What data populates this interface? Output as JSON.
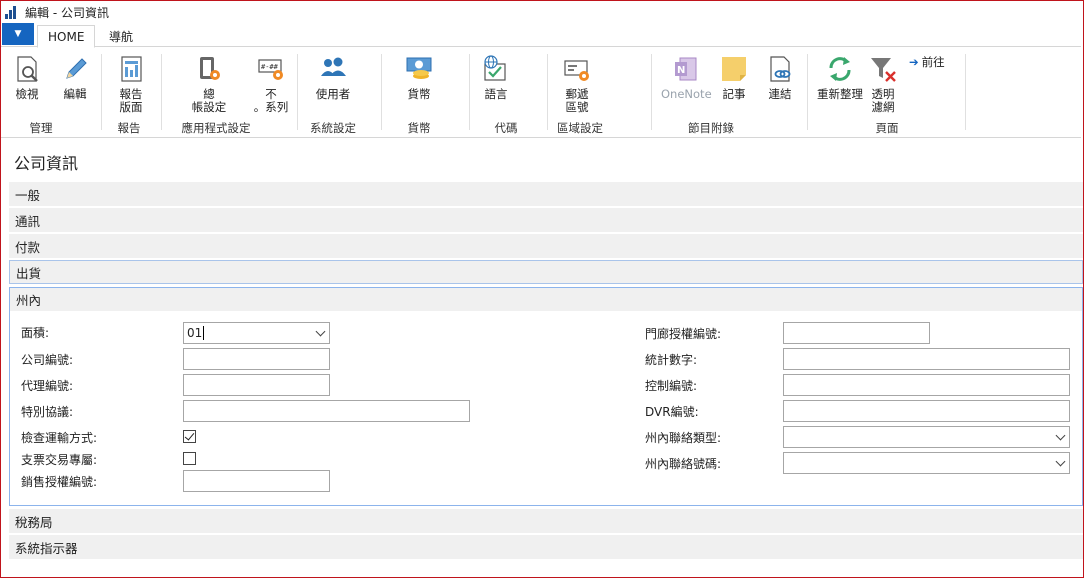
{
  "window": {
    "title": "編輯 - 公司資訊"
  },
  "tabs": [
    {
      "label": "HOME"
    },
    {
      "label": "導航"
    }
  ],
  "ribbon": {
    "buttons": {
      "view": "檢視",
      "edit": "編輯",
      "report_layout_1": "報告",
      "report_layout_2": "版面",
      "gl_setup_1": "總",
      "gl_setup_2": "帳設定",
      "no_series_1": "不",
      "no_series_2": "。系列",
      "users": "使用者",
      "currency": "貨幣",
      "language": "語言",
      "postcode_1": "郵遞",
      "postcode_2": "區號",
      "onenote": "OneNote",
      "notes": "記事",
      "links": "連結",
      "refresh": "重新整理",
      "clear_filter_1": "透明",
      "clear_filter_2": "濾網",
      "goto": "前往"
    },
    "groups": {
      "manage": "管理",
      "report": "報告",
      "app_setup": "應用程式設定",
      "system_setup": "系統設定",
      "currency": "貨幣",
      "codes": "代碼",
      "regional": "區域設定",
      "show_attached": "節目附錄",
      "page": "頁面"
    }
  },
  "page": {
    "title": "公司資訊"
  },
  "sections": {
    "general": "一般",
    "communication": "通訊",
    "payments": "付款",
    "shipping": "出貨",
    "intrastat": "州內",
    "tax_office": "稅務局",
    "system_indicator": "系統指示器"
  },
  "intrastat": {
    "area_label": "面積:",
    "area_value": "01",
    "company_no_label": "公司編號:",
    "agent_no_label": "代理編號:",
    "special_agreement_label": "特別協議:",
    "check_transport_label": "檢查運輸方式:",
    "check_transport_checked": true,
    "cheque_trade_label": "支票交易專屬:",
    "cheque_trade_checked": false,
    "sales_auth_label": "銷售授權編號:",
    "gate_auth_label": "門廊授權編號:",
    "stat_number_label": "統計數字:",
    "control_no_label": "控制編號:",
    "dvr_no_label": "DVR編號:",
    "contact_type_label": "州內聯絡類型:",
    "contact_no_label": "州內聯絡號碼:"
  }
}
